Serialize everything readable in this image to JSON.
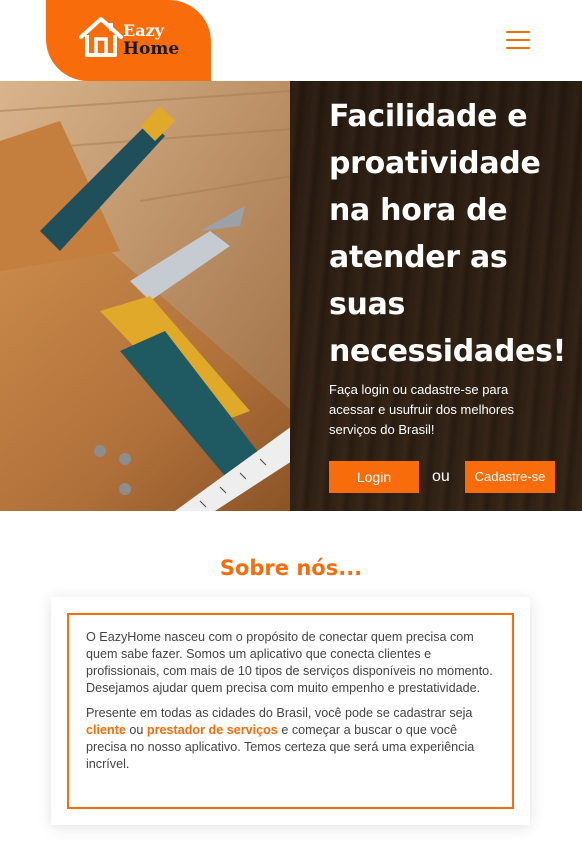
{
  "brand": {
    "name_line1": "Eazy",
    "name_line2": "Home",
    "accent_color": "#f96c0c",
    "logo_icon": "house-icon"
  },
  "nav": {
    "menu_icon": "hamburger-menu-icon"
  },
  "hero": {
    "title": "Facilidade e proatividade na hora de atender as suas necessidades!",
    "subtitle": "Faça login ou cadastre-se para acessar e usufruir dos melhores serviços do Brasil!",
    "login_label": "Login",
    "or_label": "ou",
    "signup_label": "Cadastre-se"
  },
  "about": {
    "title": "Sobre nós...",
    "paragraph1": "O EazyHome nasceu com o propósito de conectar quem precisa com quem sabe fazer. Somos um aplicativo que conecta clientes e profissionais, com mais de 10 tipos de serviços disponíveis no momento. Desejamos ajudar quem precisa com muito empenho e prestatividade.",
    "p2_before": "Presente em todas as cidades do Brasil, você pode se cadastrar seja ",
    "p2_client": "cliente",
    "p2_or": " ou ",
    "p2_provider": "prestador de serviços",
    "p2_after": " e começar a buscar o que você precisa no nosso aplicativo. Temos certeza que será uma experiência incrível."
  }
}
